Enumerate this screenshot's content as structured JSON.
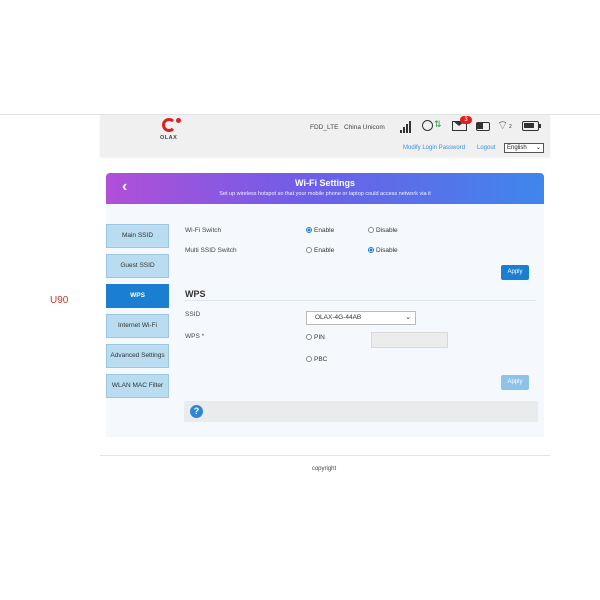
{
  "side_label": "U90",
  "header": {
    "logo_text": "OLAX",
    "network_type": "FDD_LTE",
    "operator": "China Unicom",
    "message_count": "3",
    "wifi_clients": "2",
    "modify_password_link": "Modify Login Password",
    "logout_link": "Logout",
    "language": "English"
  },
  "banner": {
    "back_icon": "chevron-left-icon",
    "title": "Wi-Fi Settings",
    "subtitle": "Set up wireless hotspot so that your mobile phone or laptop could access network via it"
  },
  "sidebar": {
    "items": [
      {
        "label": "Main SSID",
        "active": false
      },
      {
        "label": "Guest SSID",
        "active": false
      },
      {
        "label": "WPS",
        "active": true
      },
      {
        "label": "Internet Wi-Fi",
        "active": false
      },
      {
        "label": "Advanced Settings",
        "active": false
      },
      {
        "label": "WLAN MAC Filter",
        "active": false
      }
    ]
  },
  "wifi_settings": {
    "wifi_switch_label": "Wi-Fi Switch",
    "multi_ssid_label": "Multi SSID Switch",
    "enable_label": "Enable",
    "disable_label": "Disable",
    "wifi_switch_value": "Enable",
    "multi_ssid_value": "Disable",
    "apply_label": "Apply"
  },
  "wps": {
    "section_title": "WPS",
    "ssid_label": "SSID",
    "ssid_value": "OLAX-4G-44AB",
    "wps_label": "WPS *",
    "pin_label": "PIN",
    "pbc_label": "PBC",
    "apply_label": "Apply"
  },
  "help_icon": "question-icon",
  "footer": {
    "copyright": "copyright"
  },
  "colors": {
    "primary": "#1a7fd0",
    "nav_inactive": "#b9dcf0",
    "banner_start": "#b14fd8",
    "banner_end": "#3f86ec",
    "logo_red": "#e02020"
  }
}
